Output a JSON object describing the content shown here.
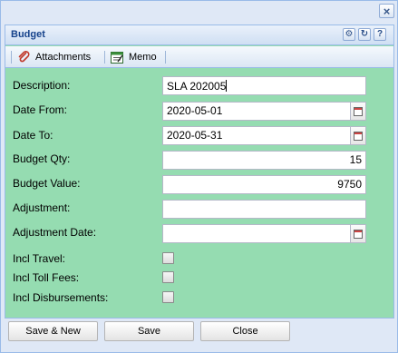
{
  "window": {
    "close_glyph": "×"
  },
  "panel": {
    "title": "Budget",
    "tools": [
      {
        "name": "gear-tool",
        "glyph": "⚙"
      },
      {
        "name": "refresh-tool",
        "glyph": "↻"
      },
      {
        "name": "help-tool",
        "glyph": "?"
      }
    ]
  },
  "toolbar": {
    "attachments_label": "Attachments",
    "memo_label": "Memo",
    "attachments_icon": "paperclip-icon",
    "memo_icon": "notepad-icon"
  },
  "form": {
    "description": {
      "label": "Description:",
      "value": "SLA 202005"
    },
    "date_from": {
      "label": "Date From:",
      "value": "2020-05-01"
    },
    "date_to": {
      "label": "Date To:",
      "value": "2020-05-31"
    },
    "budget_qty": {
      "label": "Budget Qty:",
      "value": "15"
    },
    "budget_value": {
      "label": "Budget Value:",
      "value": "9750"
    },
    "adjustment": {
      "label": "Adjustment:",
      "value": ""
    },
    "adjustment_date": {
      "label": "Adjustment Date:",
      "value": ""
    },
    "incl_travel": {
      "label": "Incl Travel:",
      "checked": false
    },
    "incl_toll_fees": {
      "label": "Incl Toll Fees:",
      "checked": false
    },
    "incl_disbursements": {
      "label": "Incl Disbursements:",
      "checked": false
    }
  },
  "buttons": {
    "save_new": "Save & New",
    "save": "Save",
    "close": "Close"
  },
  "colors": {
    "form_background": "#95dcb1",
    "title_text": "#15428b",
    "window_background": "#dfe8f6"
  }
}
